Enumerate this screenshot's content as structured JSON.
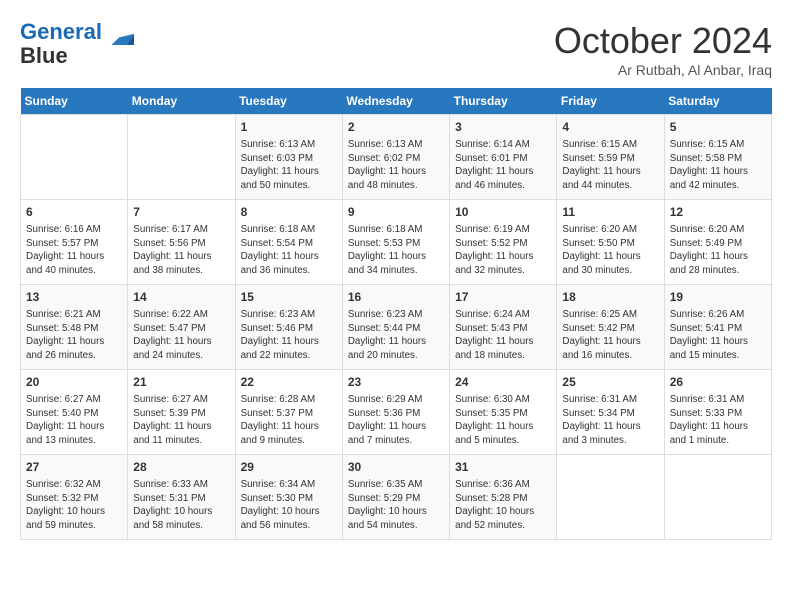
{
  "header": {
    "logo_line1": "General",
    "logo_line2": "Blue",
    "month": "October 2024",
    "location": "Ar Rutbah, Al Anbar, Iraq"
  },
  "weekdays": [
    "Sunday",
    "Monday",
    "Tuesday",
    "Wednesday",
    "Thursday",
    "Friday",
    "Saturday"
  ],
  "weeks": [
    [
      {
        "day": "",
        "info": ""
      },
      {
        "day": "",
        "info": ""
      },
      {
        "day": "1",
        "info": "Sunrise: 6:13 AM\nSunset: 6:03 PM\nDaylight: 11 hours and 50 minutes."
      },
      {
        "day": "2",
        "info": "Sunrise: 6:13 AM\nSunset: 6:02 PM\nDaylight: 11 hours and 48 minutes."
      },
      {
        "day": "3",
        "info": "Sunrise: 6:14 AM\nSunset: 6:01 PM\nDaylight: 11 hours and 46 minutes."
      },
      {
        "day": "4",
        "info": "Sunrise: 6:15 AM\nSunset: 5:59 PM\nDaylight: 11 hours and 44 minutes."
      },
      {
        "day": "5",
        "info": "Sunrise: 6:15 AM\nSunset: 5:58 PM\nDaylight: 11 hours and 42 minutes."
      }
    ],
    [
      {
        "day": "6",
        "info": "Sunrise: 6:16 AM\nSunset: 5:57 PM\nDaylight: 11 hours and 40 minutes."
      },
      {
        "day": "7",
        "info": "Sunrise: 6:17 AM\nSunset: 5:56 PM\nDaylight: 11 hours and 38 minutes."
      },
      {
        "day": "8",
        "info": "Sunrise: 6:18 AM\nSunset: 5:54 PM\nDaylight: 11 hours and 36 minutes."
      },
      {
        "day": "9",
        "info": "Sunrise: 6:18 AM\nSunset: 5:53 PM\nDaylight: 11 hours and 34 minutes."
      },
      {
        "day": "10",
        "info": "Sunrise: 6:19 AM\nSunset: 5:52 PM\nDaylight: 11 hours and 32 minutes."
      },
      {
        "day": "11",
        "info": "Sunrise: 6:20 AM\nSunset: 5:50 PM\nDaylight: 11 hours and 30 minutes."
      },
      {
        "day": "12",
        "info": "Sunrise: 6:20 AM\nSunset: 5:49 PM\nDaylight: 11 hours and 28 minutes."
      }
    ],
    [
      {
        "day": "13",
        "info": "Sunrise: 6:21 AM\nSunset: 5:48 PM\nDaylight: 11 hours and 26 minutes."
      },
      {
        "day": "14",
        "info": "Sunrise: 6:22 AM\nSunset: 5:47 PM\nDaylight: 11 hours and 24 minutes."
      },
      {
        "day": "15",
        "info": "Sunrise: 6:23 AM\nSunset: 5:46 PM\nDaylight: 11 hours and 22 minutes."
      },
      {
        "day": "16",
        "info": "Sunrise: 6:23 AM\nSunset: 5:44 PM\nDaylight: 11 hours and 20 minutes."
      },
      {
        "day": "17",
        "info": "Sunrise: 6:24 AM\nSunset: 5:43 PM\nDaylight: 11 hours and 18 minutes."
      },
      {
        "day": "18",
        "info": "Sunrise: 6:25 AM\nSunset: 5:42 PM\nDaylight: 11 hours and 16 minutes."
      },
      {
        "day": "19",
        "info": "Sunrise: 6:26 AM\nSunset: 5:41 PM\nDaylight: 11 hours and 15 minutes."
      }
    ],
    [
      {
        "day": "20",
        "info": "Sunrise: 6:27 AM\nSunset: 5:40 PM\nDaylight: 11 hours and 13 minutes."
      },
      {
        "day": "21",
        "info": "Sunrise: 6:27 AM\nSunset: 5:39 PM\nDaylight: 11 hours and 11 minutes."
      },
      {
        "day": "22",
        "info": "Sunrise: 6:28 AM\nSunset: 5:37 PM\nDaylight: 11 hours and 9 minutes."
      },
      {
        "day": "23",
        "info": "Sunrise: 6:29 AM\nSunset: 5:36 PM\nDaylight: 11 hours and 7 minutes."
      },
      {
        "day": "24",
        "info": "Sunrise: 6:30 AM\nSunset: 5:35 PM\nDaylight: 11 hours and 5 minutes."
      },
      {
        "day": "25",
        "info": "Sunrise: 6:31 AM\nSunset: 5:34 PM\nDaylight: 11 hours and 3 minutes."
      },
      {
        "day": "26",
        "info": "Sunrise: 6:31 AM\nSunset: 5:33 PM\nDaylight: 11 hours and 1 minute."
      }
    ],
    [
      {
        "day": "27",
        "info": "Sunrise: 6:32 AM\nSunset: 5:32 PM\nDaylight: 10 hours and 59 minutes."
      },
      {
        "day": "28",
        "info": "Sunrise: 6:33 AM\nSunset: 5:31 PM\nDaylight: 10 hours and 58 minutes."
      },
      {
        "day": "29",
        "info": "Sunrise: 6:34 AM\nSunset: 5:30 PM\nDaylight: 10 hours and 56 minutes."
      },
      {
        "day": "30",
        "info": "Sunrise: 6:35 AM\nSunset: 5:29 PM\nDaylight: 10 hours and 54 minutes."
      },
      {
        "day": "31",
        "info": "Sunrise: 6:36 AM\nSunset: 5:28 PM\nDaylight: 10 hours and 52 minutes."
      },
      {
        "day": "",
        "info": ""
      },
      {
        "day": "",
        "info": ""
      }
    ]
  ]
}
